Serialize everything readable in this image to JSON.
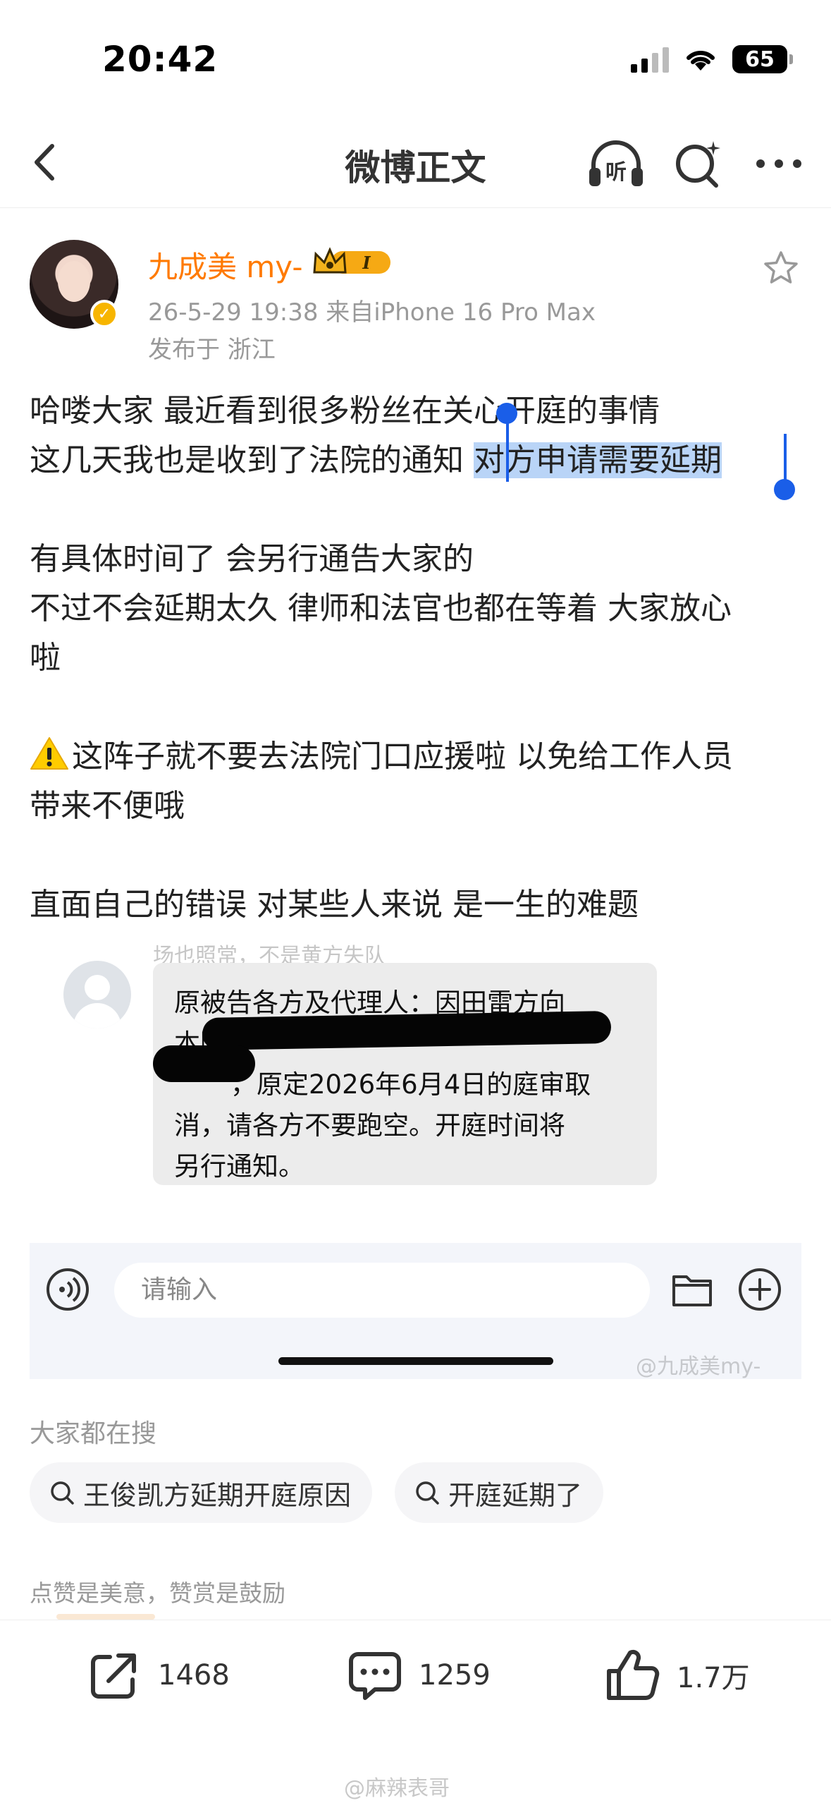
{
  "status_bar": {
    "time": "20:42",
    "battery": "65"
  },
  "nav": {
    "title": "微博正文"
  },
  "post": {
    "username": "九成美 my-",
    "vip_level": "I",
    "meta": "26-5-29 19:38  来自iPhone 16 Pro Max",
    "location": "发布于 浙江",
    "lines": {
      "l1": "哈喽大家 最近看到很多粉丝在关心开庭的事情",
      "l2_plain": "这几天我也是收到了法院的通知 ",
      "l2_selected": "对方申请需要延期",
      "l3": "有具体时间了 会另行通告大家的",
      "l4": "不过不会延期太久 律师和法官也都在等着 大家放心",
      "l5": "啦",
      "l6": "这阵子就不要去法院门口应援啦 以免给工作人员",
      "l7": "带来不便哦",
      "l8": "直面自己的错误 对某些人来说 是一生的难题"
    }
  },
  "embedded": {
    "top_text": "场也照常，不是黄方失队",
    "bubble": {
      "line1": "原被告各方及代理人：因田雷方向",
      "line2": "本院",
      "line3": "，原定2026年6月4日的庭审取",
      "line4": "消，请各方不要跑空。开庭时间将",
      "line5": "另行通知。"
    },
    "input_placeholder": "请输入",
    "watermark": "@九成美my-"
  },
  "hot_search": {
    "title": "大家都在搜",
    "items": [
      "王俊凯方延期开庭原因",
      "开庭延期了"
    ]
  },
  "reward_text": "点赞是美意，赞赏是鼓励",
  "actions": {
    "share": "1468",
    "comment": "1259",
    "like": "1.7万"
  },
  "bottom_watermark": "@麻辣表哥"
}
